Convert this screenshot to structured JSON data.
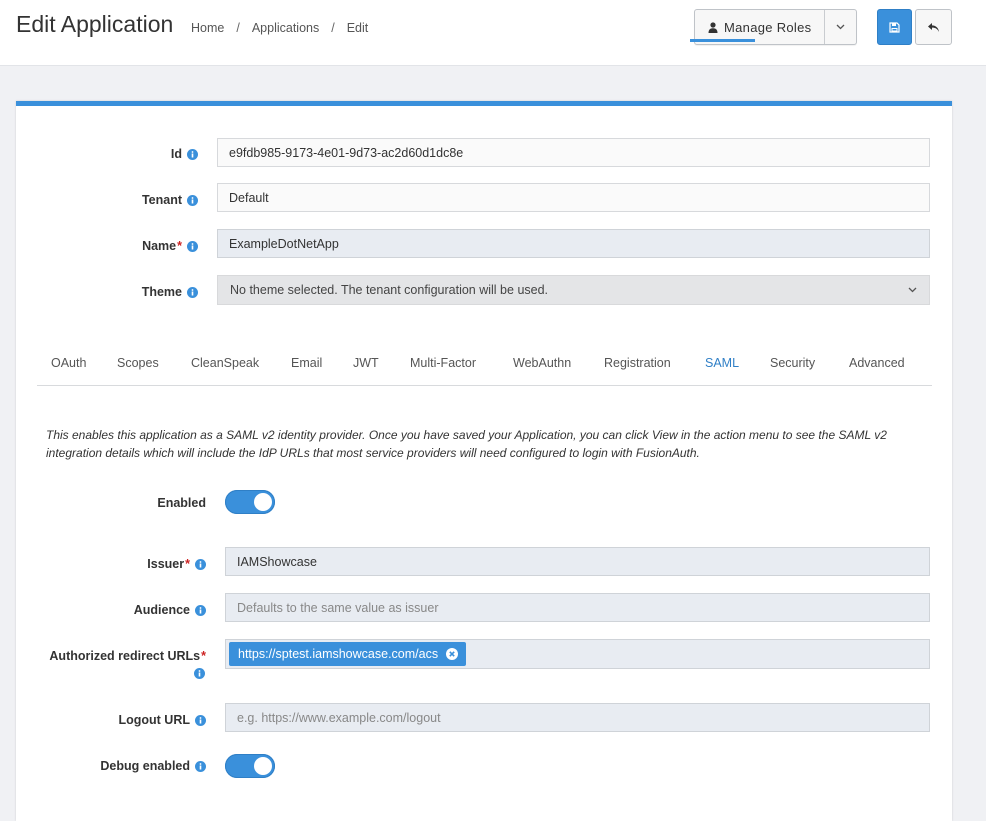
{
  "header": {
    "title": "Edit Application",
    "breadcrumb": [
      "Home",
      "Applications",
      "Edit"
    ],
    "breadcrumb_separator": "/",
    "manage_roles_label": "Manage Roles"
  },
  "form": {
    "id": {
      "label": "Id",
      "value": "e9fdb985-9173-4e01-9d73-ac2d60d1dc8e"
    },
    "tenant": {
      "label": "Tenant",
      "value": "Default"
    },
    "name": {
      "label": "Name",
      "required": "*",
      "value": "ExampleDotNetApp"
    },
    "theme": {
      "label": "Theme",
      "value": "No theme selected. The tenant configuration will be used."
    }
  },
  "tabs": [
    "OAuth",
    "Scopes",
    "CleanSpeak",
    "Email",
    "JWT",
    "Multi-Factor",
    "WebAuthn",
    "Registration",
    "SAML",
    "Security",
    "Advanced"
  ],
  "active_tab": "SAML",
  "saml": {
    "description": "This enables this application as a SAML v2 identity provider. Once you have saved your Application, you can click View in the action menu to see the SAML v2 integration details which will include the IdP URLs that most service providers will need configured to login with FusionAuth.",
    "enabled": {
      "label": "Enabled",
      "on": true
    },
    "issuer": {
      "label": "Issuer",
      "required": "*",
      "value": "IAMShowcase"
    },
    "audience": {
      "label": "Audience",
      "placeholder": "Defaults to the same value as issuer"
    },
    "redirect_urls": {
      "label": "Authorized redirect URLs",
      "required": "*",
      "tags": [
        "https://sptest.iamshowcase.com/acs"
      ]
    },
    "logout_url": {
      "label": "Logout URL",
      "placeholder": "e.g. https://www.example.com/logout"
    },
    "debug": {
      "label": "Debug enabled",
      "on": true
    }
  },
  "colors": {
    "accent": "#3a90db",
    "required": "#cc2222",
    "page_bg": "#f0f1f4"
  }
}
